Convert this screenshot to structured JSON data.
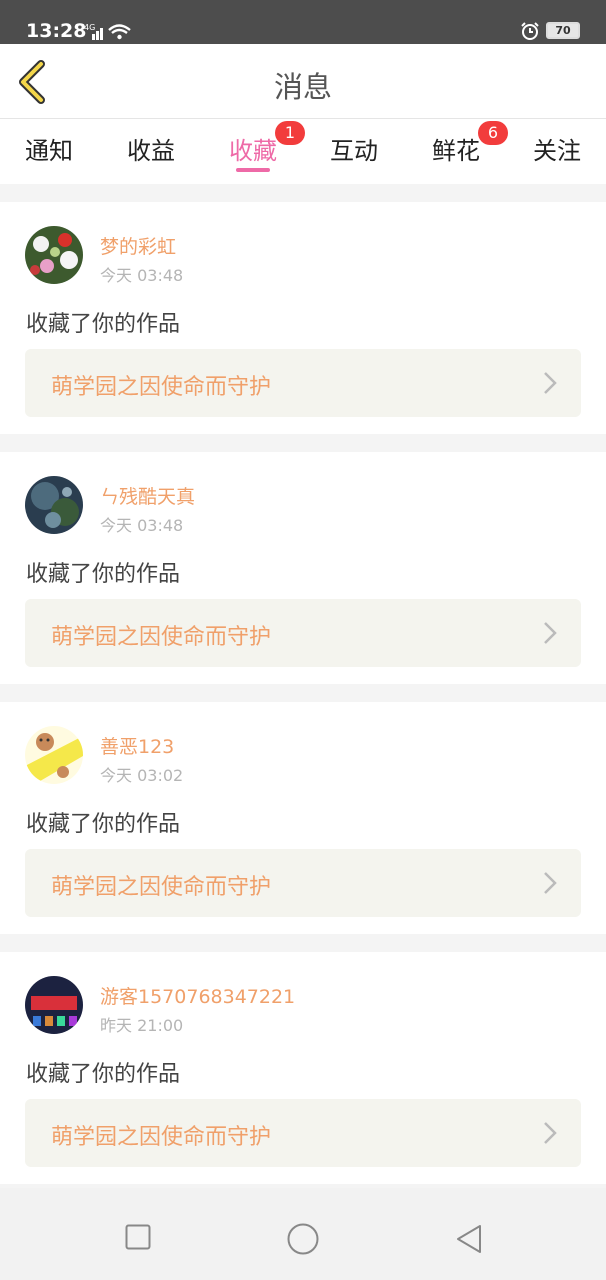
{
  "status_bar": {
    "time": "13:28",
    "network": "4G",
    "battery": "70"
  },
  "header": {
    "title": "消息"
  },
  "tabs": [
    {
      "label": "通知",
      "active": false,
      "badge": ""
    },
    {
      "label": "收益",
      "active": false,
      "badge": ""
    },
    {
      "label": "收藏",
      "active": true,
      "badge": "1"
    },
    {
      "label": "互动",
      "active": false,
      "badge": ""
    },
    {
      "label": "鲜花",
      "active": false,
      "badge": "6"
    },
    {
      "label": "关注",
      "active": false,
      "badge": ""
    }
  ],
  "messages": [
    {
      "user": "梦的彩虹",
      "time": "今天 03:48",
      "action": "收藏了你的作品",
      "work": "萌学园之因使命而守护"
    },
    {
      "user": "ㄣ残酷天真",
      "time": "今天 03:48",
      "action": "收藏了你的作品",
      "work": "萌学园之因使命而守护"
    },
    {
      "user": "善恶123",
      "time": "今天 03:02",
      "action": "收藏了你的作品",
      "work": "萌学园之因使命而守护"
    },
    {
      "user": "游客1570768347221",
      "time": "昨天 21:00",
      "action": "收藏了你的作品",
      "work": "萌学园之因使命而守护"
    }
  ],
  "colors": {
    "accent_pink": "#ee6aa7",
    "username_orange": "#f0a06a",
    "badge_red": "#f23c3c"
  }
}
